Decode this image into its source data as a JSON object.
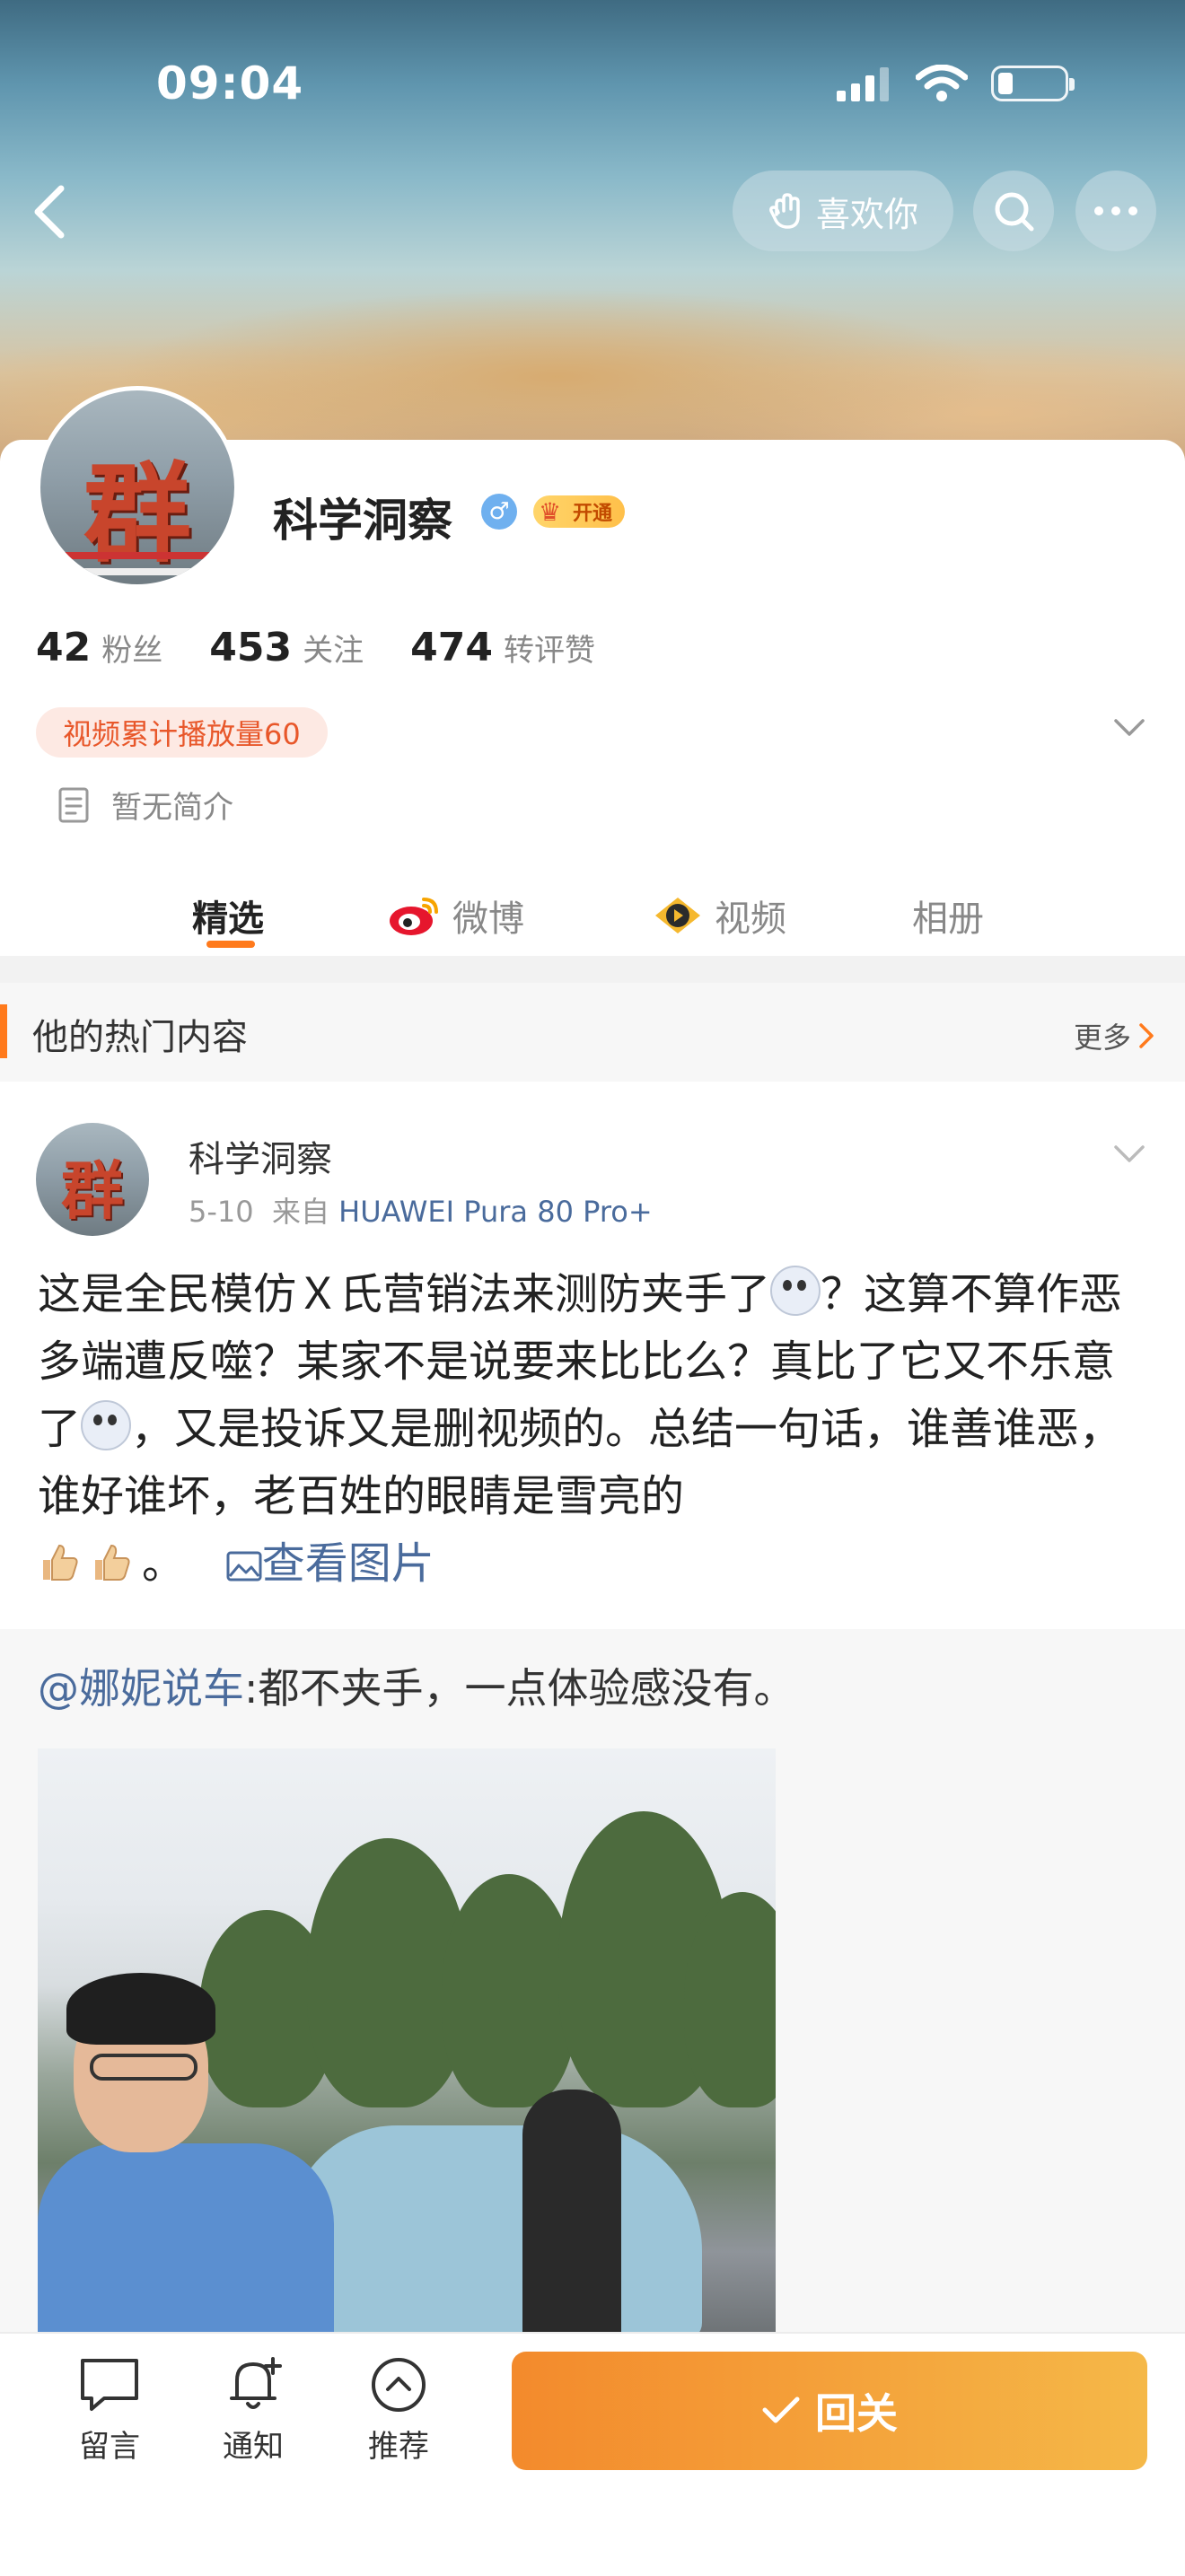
{
  "status_bar": {
    "time": "09:04"
  },
  "header": {
    "like_label": "喜欢你"
  },
  "profile": {
    "name": "科学洞察",
    "gender_symbol": "♂",
    "vip_badge": "开通",
    "stats": [
      {
        "value": "42",
        "label": "粉丝"
      },
      {
        "value": "453",
        "label": "关注"
      },
      {
        "value": "474",
        "label": "转评赞"
      }
    ],
    "play_tag": "视频累计播放量60",
    "bio": "暂无简介"
  },
  "tabs": [
    {
      "label": "精选",
      "active": true
    },
    {
      "label": "微博",
      "active": false
    },
    {
      "label": "视频",
      "active": false
    },
    {
      "label": "相册",
      "active": false
    }
  ],
  "section": {
    "title": "他的热门内容",
    "more": "更多"
  },
  "post": {
    "author": "科学洞察",
    "date": "5-10",
    "from_prefix": "来自",
    "device": "HUAWEI Pura 80 Pro+",
    "text_1": "这是全民模仿Ｘ氏营销法来测防夹手了",
    "text_2": "？这算不算作恶多端遭反噬？某家不是说要来比比么？真比了它又不乐意了",
    "text_3": "，又是投诉又是删视频的。总结一句话，谁善谁恶，谁好谁坏，老百姓的眼睛是雪亮的",
    "text_4": "。",
    "view_pic": "查看图片",
    "repost_user": "@娜妮说车",
    "repost_text": ":都不夹手，一点体验感没有。"
  },
  "bottom_bar": {
    "items": [
      {
        "label": "留言",
        "icon": "comment-icon"
      },
      {
        "label": "通知",
        "icon": "bell-icon"
      },
      {
        "label": "推荐",
        "icon": "chevron-up-circle-icon"
      }
    ],
    "follow_label": "回关"
  },
  "colors": {
    "accent": "#ff7a1c",
    "link": "#4a6b9c",
    "follow_gradient_start": "#f38a2c",
    "follow_gradient_end": "#f5b848"
  }
}
